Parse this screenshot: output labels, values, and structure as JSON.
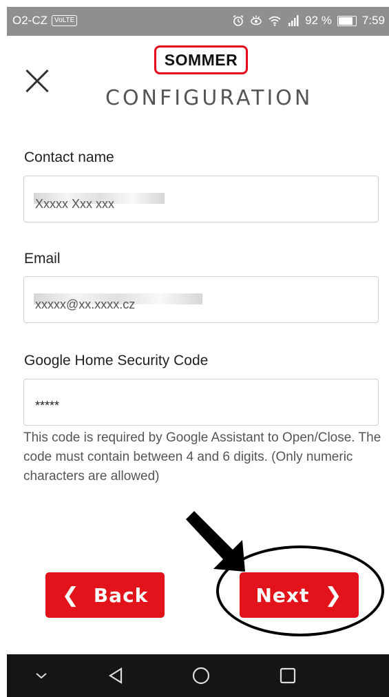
{
  "status_bar": {
    "carrier": "O2-CZ",
    "volte_badge": "VoLTE",
    "battery_percent": "92 %",
    "battery_level": 0.92,
    "time": "7:59",
    "icons": [
      "alarm-icon",
      "eye-comfort-icon",
      "wifi-icon",
      "signal-icon",
      "battery-icon"
    ]
  },
  "header": {
    "logo_text": "SOMMER",
    "title": "CONFIGURATION",
    "close_icon": "close-icon"
  },
  "form": {
    "contact_label": "Contact name",
    "contact_value": "Xxxxx Xxx xxx",
    "email_label": "Email",
    "email_value": "xxxxx@xx.xxxx.cz",
    "code_label": "Google Home Security Code",
    "code_value": "*****",
    "help_text": "This code is required by Google Assistant to Open/Close. The code must contain between 4 and 6 digits. (Only numeric characters are allowed)"
  },
  "buttons": {
    "back_label": "Back",
    "next_label": "Next"
  },
  "nav_bar": {
    "icons": [
      "collapse-icon",
      "back-triangle-icon",
      "home-circle-icon",
      "recents-square-icon"
    ]
  },
  "colors": {
    "accent": "#e3131b",
    "status_bar": "#8f8f8f",
    "nav_bar": "#151515"
  }
}
